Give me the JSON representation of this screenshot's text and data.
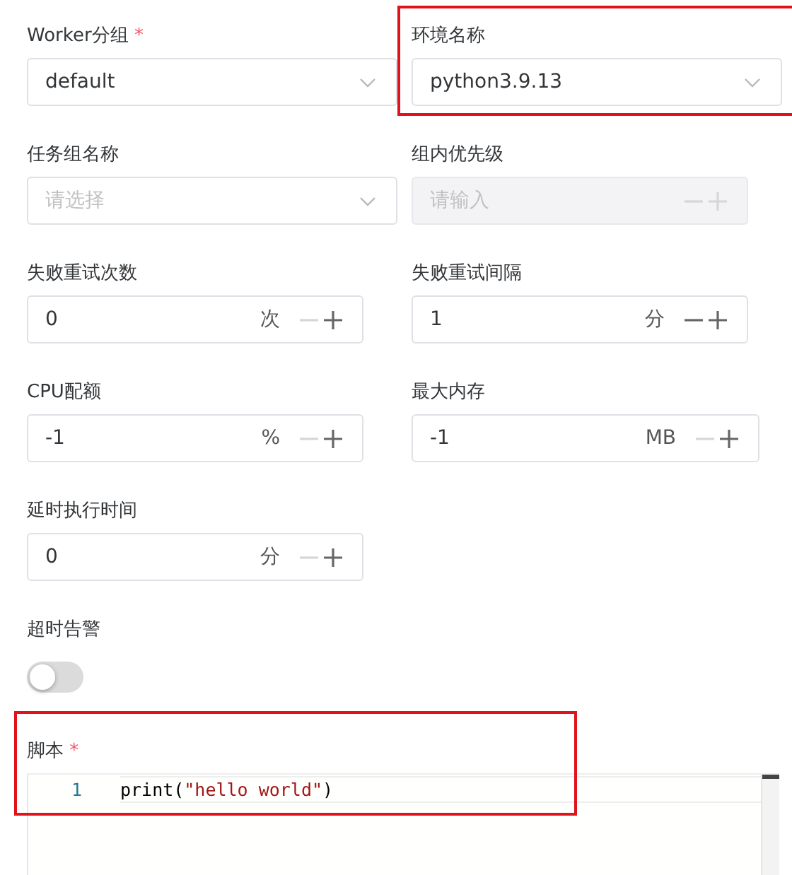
{
  "fields": [
    {
      "kind": "select",
      "label": "Worker分组",
      "required_mark": "*",
      "value": "default",
      "disabled": false
    },
    {
      "kind": "select",
      "label": "环境名称",
      "value": "python3.9.13",
      "disabled": false,
      "highlighted": true
    },
    {
      "kind": "select",
      "label": "任务组名称",
      "placeholder": "请选择",
      "disabled": false
    },
    {
      "kind": "number",
      "label": "组内优先级",
      "placeholder": "请输入",
      "disabled": true,
      "decrement_disabled": true
    },
    {
      "kind": "number",
      "label": "失败重试次数",
      "value": "0",
      "unit": "次",
      "disabled": false,
      "decrement_disabled": true
    },
    {
      "kind": "number",
      "label": "失败重试间隔",
      "value": "1",
      "unit": "分",
      "disabled": false,
      "decrement_disabled": false
    },
    {
      "kind": "number",
      "label": "CPU配额",
      "value": "-1",
      "unit": "%",
      "disabled": false,
      "decrement_disabled": true
    },
    {
      "kind": "number",
      "label": "最大内存",
      "value": "-1",
      "unit": "MB",
      "disabled": false,
      "decrement_disabled": true
    },
    {
      "kind": "number",
      "label": "延时执行时间",
      "value": "0",
      "unit": "分",
      "disabled": false,
      "decrement_disabled": true
    }
  ],
  "timeout_alarm": {
    "label": "超时告警",
    "on": false
  },
  "script": {
    "label": "脚本",
    "required_mark": "*",
    "highlighted": true,
    "lines": [
      {
        "number": "1",
        "tokens": [
          {
            "kind": "plain",
            "text": "print("
          },
          {
            "kind": "string",
            "text": "\"hello world\""
          },
          {
            "kind": "plain",
            "text": ")"
          }
        ]
      }
    ]
  }
}
